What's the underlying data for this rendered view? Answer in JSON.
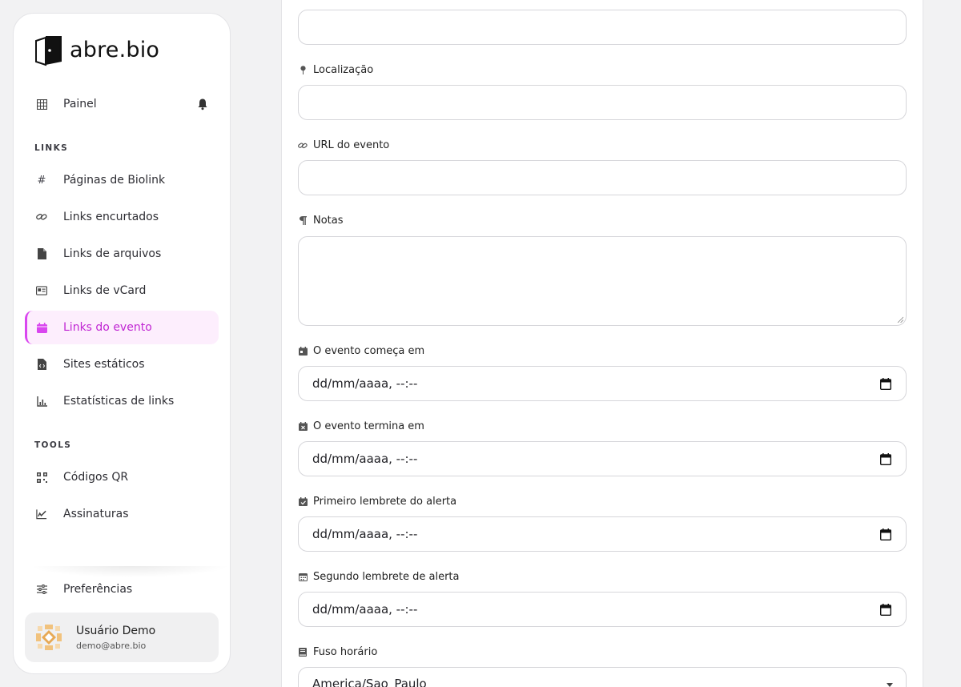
{
  "brand": {
    "name": "abre.bio"
  },
  "nav": {
    "dashboard": {
      "label": "Painel",
      "icon": "grid-icon"
    },
    "links_section": "LINKS",
    "links": [
      {
        "label": "Páginas de Biolink",
        "icon": "hash-icon"
      },
      {
        "label": "Links encurtados",
        "icon": "link-icon"
      },
      {
        "label": "Links de arquivos",
        "icon": "file-icon"
      },
      {
        "label": "Links de vCard",
        "icon": "id-card-icon"
      },
      {
        "label": "Links do evento",
        "icon": "calendar-icon",
        "active": true
      },
      {
        "label": "Sites estáticos",
        "icon": "file-code-icon"
      },
      {
        "label": "Estatísticas de links",
        "icon": "chart-icon"
      }
    ],
    "tools_section": "TOOLS",
    "tools": [
      {
        "label": "Códigos QR",
        "icon": "qrcode-icon"
      },
      {
        "label": "Assinaturas",
        "icon": "signature-icon"
      }
    ],
    "preferences": {
      "label": "Preferências",
      "icon": "sliders-icon"
    }
  },
  "user": {
    "name": "Usuário Demo",
    "email": "demo@abre.bio"
  },
  "form": {
    "location": {
      "label": "Localização",
      "value": ""
    },
    "url": {
      "label": "URL do evento",
      "value": ""
    },
    "notes": {
      "label": "Notas",
      "value": ""
    },
    "start": {
      "label": "O evento começa em",
      "value": "dd/mm/aaaa, --:--"
    },
    "end": {
      "label": "O evento termina em",
      "value": "dd/mm/aaaa, --:--"
    },
    "first_reminder": {
      "label": "Primeiro lembrete do alerta",
      "value": "dd/mm/aaaa, --:--"
    },
    "second_reminder": {
      "label": "Segundo lembrete de alerta",
      "value": "dd/mm/aaaa, --:--"
    },
    "timezone": {
      "label": "Fuso horário",
      "value": "America/Sao_Paulo"
    }
  },
  "colors": {
    "accent": "#d946ef",
    "active_bg": "#fdeefd",
    "active_text": "#c026d3"
  }
}
